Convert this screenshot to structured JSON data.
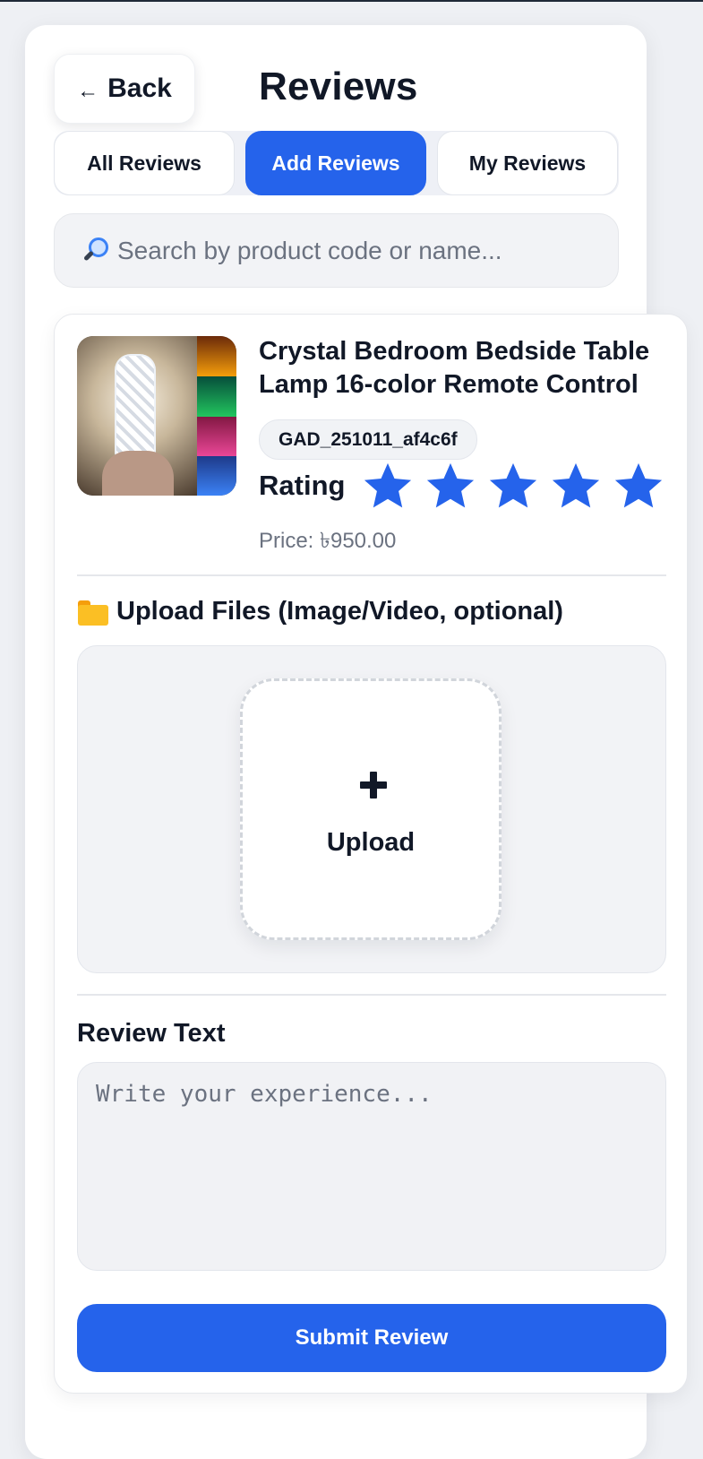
{
  "header": {
    "back_label": "Back",
    "back_arrow": "←",
    "title": "Reviews"
  },
  "tabs": [
    {
      "label": "All Reviews",
      "active": false
    },
    {
      "label": "Add Reviews",
      "active": true
    },
    {
      "label": "My Reviews",
      "active": false
    }
  ],
  "search": {
    "placeholder": "Search by product code or name...",
    "value": "",
    "icon": "magnifier-icon"
  },
  "product": {
    "title": "Crystal Bedroom Bedside Table Lamp 16-color Remote Control",
    "code": "GAD_251011_af4c6f",
    "rating_label": "Rating",
    "rating": 5,
    "rating_max": 5,
    "price": "Price: ৳950.00"
  },
  "upload": {
    "heading": "Upload Files (Image/Video, optional)",
    "heading_icon": "folder-icon",
    "tile_label": "Upload"
  },
  "review": {
    "label": "Review Text",
    "placeholder": "Write your experience...",
    "value": ""
  },
  "submit_label": "Submit Review",
  "colors": {
    "accent": "#2563eb",
    "star": "#2563eb"
  }
}
